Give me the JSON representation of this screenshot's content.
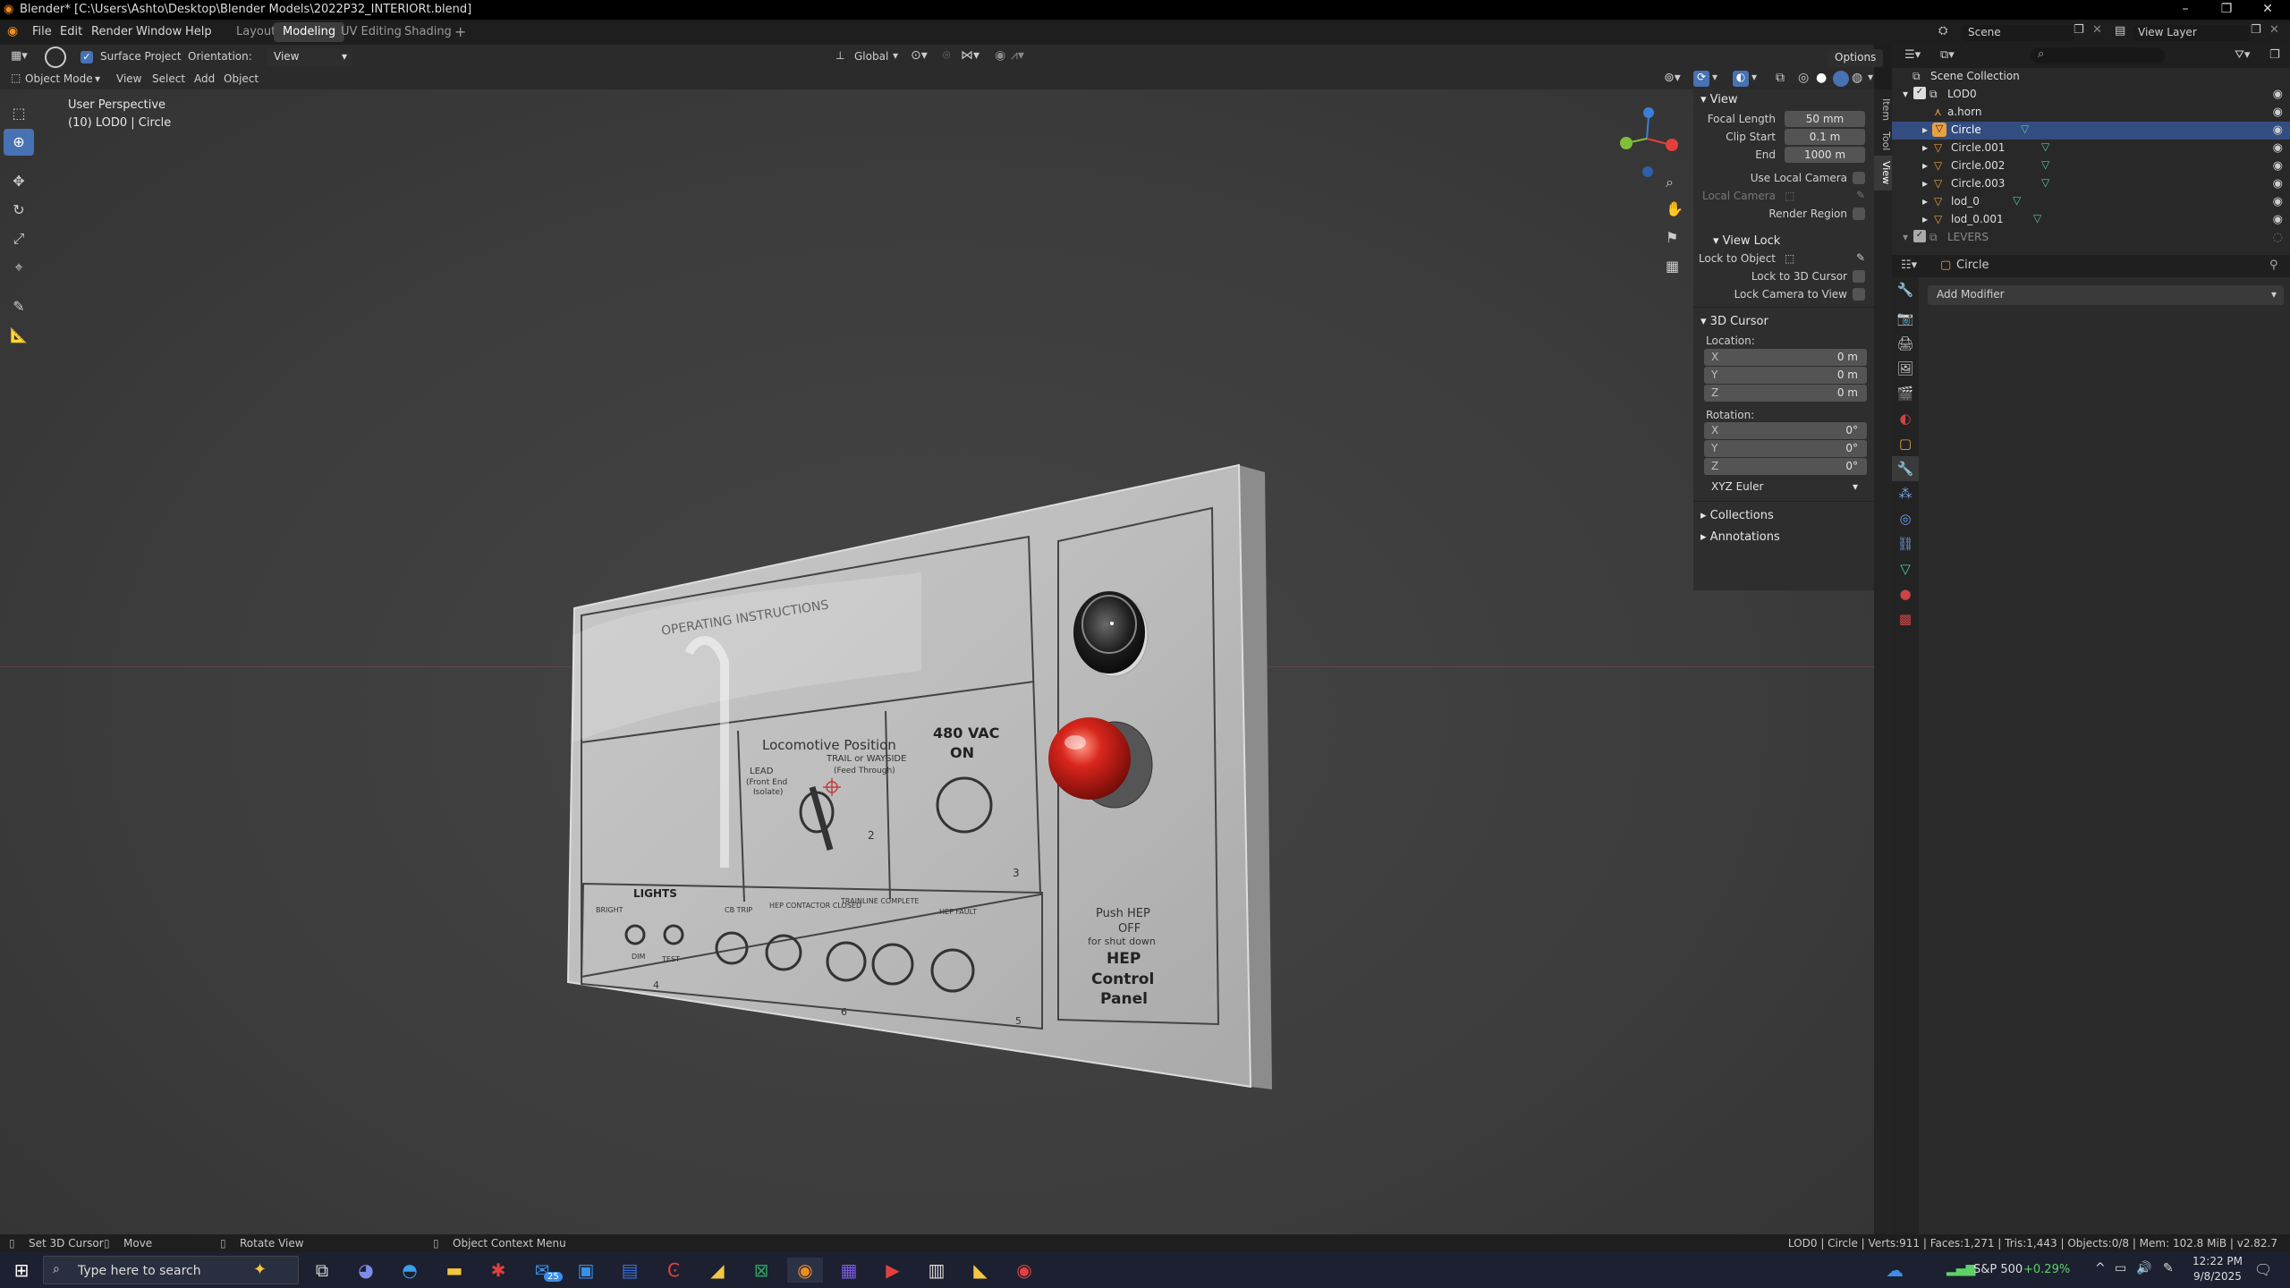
{
  "window": {
    "title": "Blender* [C:\\Users\\Ashto\\Desktop\\Blender Models\\2022P32_INTERIORt.blend]"
  },
  "menubar": {
    "items": [
      "File",
      "Edit",
      "Render",
      "Window",
      "Help"
    ]
  },
  "workspaces": {
    "tabs": [
      "Layout",
      "Modeling",
      "UV Editing",
      "Shading"
    ],
    "add": "+"
  },
  "scene": {
    "name": "Scene",
    "view_layer": "View Layer"
  },
  "tool_settings": {
    "surface_project_checkbox": "✓",
    "surface_project": "Surface Project",
    "orientation_label": "Orientation:",
    "orientation_value": "View",
    "transform_orientation": "Global",
    "options": "Options"
  },
  "viewport_header": {
    "mode": "Object Mode",
    "menus": [
      "View",
      "Select",
      "Add",
      "Object"
    ]
  },
  "viewport": {
    "perspective": "User Perspective",
    "object_info": "(10) LOD0 | Circle"
  },
  "panel_texture": {
    "operating": "OPERATING INSTRUCTIONS",
    "locomotive_position": "Locomotive Position",
    "lead": "LEAD",
    "front_end": "(Front End",
    "isolate": "Isolate)",
    "trail": "TRAIL or WAYSIDE",
    "feed": "(Feed Through)",
    "vac": "480 VAC",
    "on": "ON",
    "lights": "LIGHTS",
    "bright": "BRIGHT",
    "dim": "DIM",
    "test": "TEST",
    "cb_trip": "CB TRIP",
    "hep_contactor": "HEP CONTACTOR CLOSED",
    "trainline": "TRAINLINE COMPLETE",
    "hep_fault": "HEP FAULT",
    "push_hep": "Push HEP",
    "off": "OFF",
    "for_shut": "for shut down",
    "hep": "HEP",
    "control": "Control",
    "panel": "Panel",
    "num2": "2",
    "num3": "3",
    "num4": "4",
    "num5": "5",
    "num6": "6"
  },
  "npanel": {
    "tabs": [
      "Item",
      "Tool",
      "View"
    ],
    "view_header": "View",
    "focal_length_label": "Focal Length",
    "focal_length": "50 mm",
    "clip_start_label": "Clip Start",
    "clip_start": "0.1 m",
    "end_label": "End",
    "end": "1000 m",
    "use_local_camera": "Use Local Camera",
    "local_camera": "Local Camera",
    "render_region": "Render Region",
    "view_lock_header": "View Lock",
    "lock_to_object": "Lock to Object",
    "lock_to_3d_cursor": "Lock to 3D Cursor",
    "lock_camera_to_view": "Lock Camera to View",
    "cursor_header": "3D Cursor",
    "location_label": "Location:",
    "loc": [
      {
        "k": "X",
        "v": "0 m"
      },
      {
        "k": "Y",
        "v": "0 m"
      },
      {
        "k": "Z",
        "v": "0 m"
      }
    ],
    "rotation_label": "Rotation:",
    "rot": [
      {
        "k": "X",
        "v": "0°"
      },
      {
        "k": "Y",
        "v": "0°"
      },
      {
        "k": "Z",
        "v": "0°"
      }
    ],
    "rotation_mode": "XYZ Euler",
    "collections": "Collections",
    "annotations": "Annotations"
  },
  "outliner": {
    "root": "Scene Collection",
    "items": [
      "LOD0",
      "a.horn",
      "Circle",
      "Circle.001",
      "Circle.002",
      "Circle.003",
      "lod_0",
      "lod_0.001",
      "LEVERS"
    ]
  },
  "properties": {
    "object_name": "Circle",
    "add_modifier": "Add Modifier"
  },
  "statusbar": {
    "left": [
      "Set 3D Cursor",
      "Move",
      "Rotate View",
      "Object Context Menu"
    ],
    "right": "LOD0 | Circle | Verts:911 | Faces:1,271 | Tris:1,443 | Objects:0/8 | Mem: 102.8 MiB | v2.82.7"
  },
  "taskbar": {
    "search_placeholder": "Type here to search",
    "stock": "S&P 500",
    "stock_change": "+0.29%",
    "time": "12:22 PM",
    "date": "9/8/2025",
    "mail_badge": "25",
    "stock_change_color": "#5fd068"
  },
  "colors": {
    "accent": "#4772b3",
    "axis_x": "#e0413f",
    "axis_y": "#7fbf3c",
    "axis_z": "#3c7ed8"
  }
}
